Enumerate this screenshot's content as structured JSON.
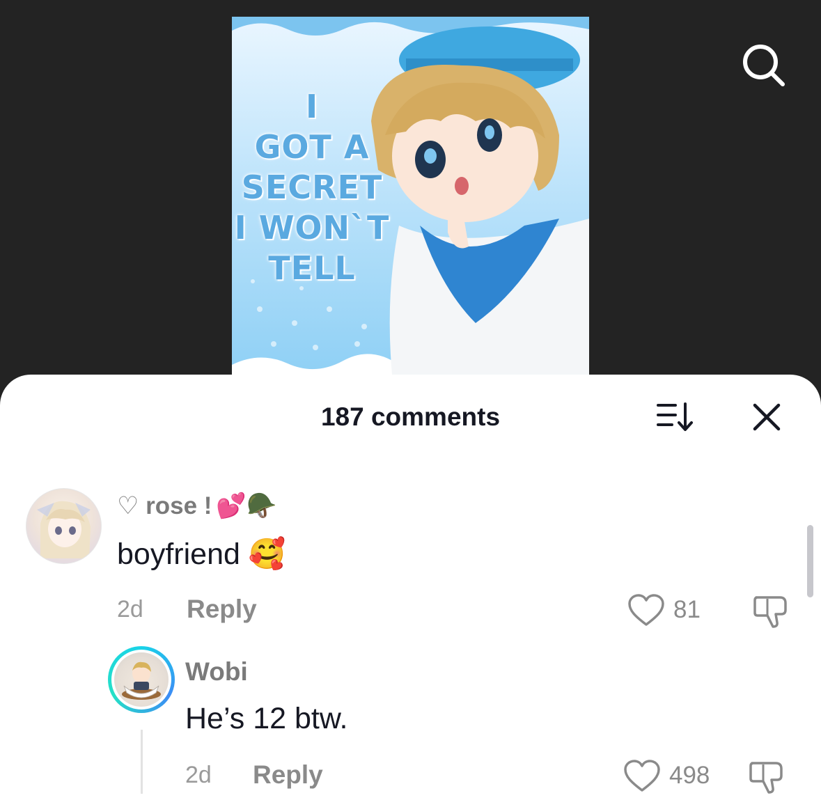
{
  "video": {
    "thumbnail_text": "I\nGOT A\nSECRET\nI WON`T\nTELL"
  },
  "sheet": {
    "title": "187 comments"
  },
  "comments": [
    {
      "username": "♡ rose !",
      "username_emoji": "💕🪖",
      "text": "boyfriend",
      "text_emoji": "🥰",
      "time": "2d",
      "reply_label": "Reply",
      "likes": "81"
    },
    {
      "username": "Wobi",
      "text": "He’s 12 btw.",
      "time": "2d",
      "reply_label": "Reply",
      "likes": "498"
    }
  ],
  "colors": {
    "background_dark": "#232323",
    "sheet": "#ffffff",
    "text_primary": "#161823",
    "text_secondary": "#8a8a8a",
    "ring_accent": "#19d3e8"
  },
  "icons": [
    "search-icon",
    "sort-icon",
    "close-icon",
    "heart-icon",
    "dislike-icon"
  ]
}
